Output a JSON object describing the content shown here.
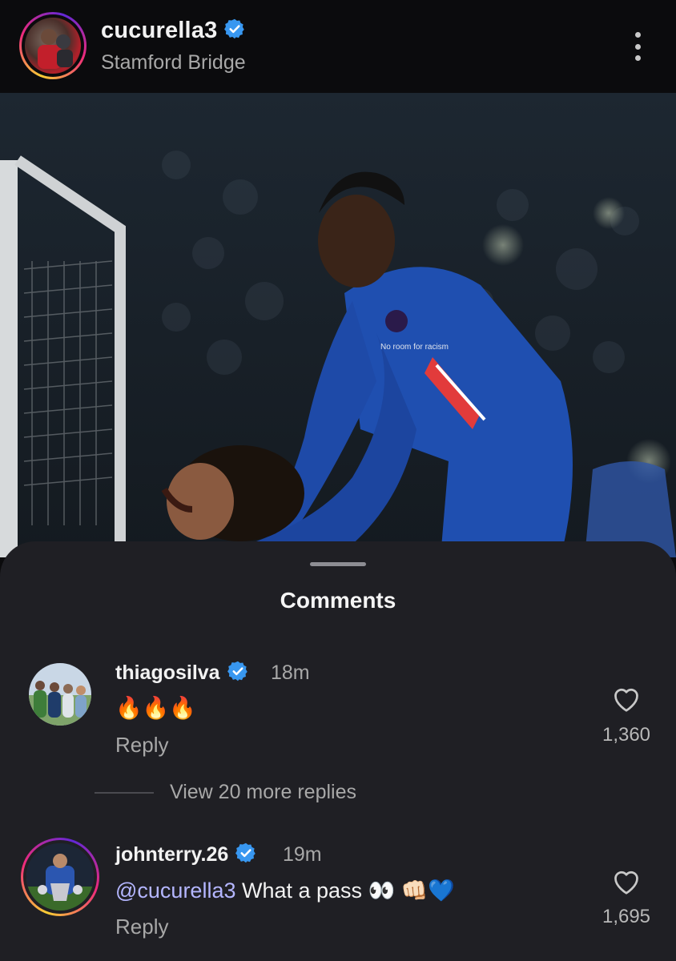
{
  "post": {
    "username": "cucurella3",
    "location": "Stamford Bridge",
    "photo_kit_text": "No room for racism"
  },
  "comments_sheet": {
    "title": "Comments",
    "comments": [
      {
        "username": "thiagosilva",
        "time": "18m",
        "text": "🔥🔥🔥",
        "reply_label": "Reply",
        "likes": "1,360",
        "view_more": "View 20 more replies"
      },
      {
        "username": "johnterry.26",
        "time": "19m",
        "mention": "@cucurella3",
        "text": " What a pass 👀 👊🏻💙",
        "reply_label": "Reply",
        "likes": "1,695"
      }
    ]
  },
  "colors": {
    "verified": "#3897f0",
    "mention": "#b4b6ff",
    "sheet": "#1f1f24",
    "kit_blue": "#1f4fb0"
  },
  "icons": [
    "verified-badge-icon",
    "more-options-icon",
    "heart-icon"
  ]
}
